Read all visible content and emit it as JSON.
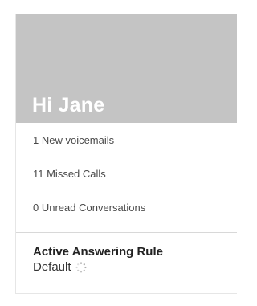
{
  "header": {
    "greeting": "Hi Jane"
  },
  "stats": [
    {
      "label": "1 New voicemails"
    },
    {
      "label": "11 Missed Calls"
    },
    {
      "label": "0 Unread Conversations"
    }
  ],
  "answering_rule": {
    "title": "Active Answering Rule",
    "value": "Default",
    "status_icon": "loading-spinner-icon"
  },
  "colors": {
    "hero_background": "#c4c4c4",
    "greeting_text": "#ffffff"
  }
}
